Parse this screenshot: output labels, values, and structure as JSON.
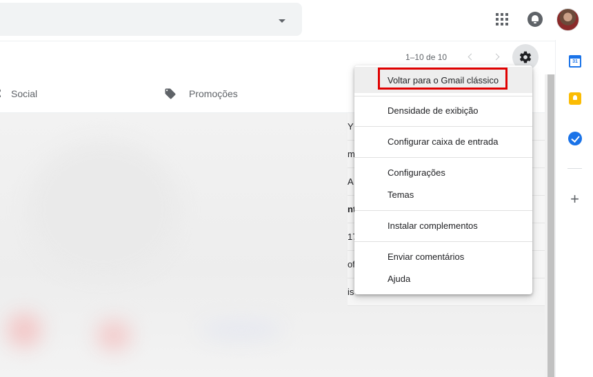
{
  "header": {
    "apps_icon": "apps-grid-icon",
    "notifications_icon": "notifications-icon",
    "avatar": "account-avatar"
  },
  "toolbar": {
    "page_count": "1–10 de 10",
    "settings_icon": "gear-icon"
  },
  "tabs": [
    {
      "label": "Social",
      "icon": "person-icon"
    },
    {
      "label": "Promoções",
      "icon": "tag-icon"
    }
  ],
  "inbox_fragments": [
    "Y",
    "m",
    "A",
    "nt",
    "17",
    "of",
    "is"
  ],
  "settings_menu": {
    "items": [
      "Voltar para o Gmail clássico",
      "Densidade de exibição",
      "Configurar caixa de entrada",
      "Configurações",
      "Temas",
      "Instalar complementos",
      "Enviar comentários",
      "Ajuda"
    ],
    "highlight_color": "#e00000"
  },
  "side_panel": {
    "calendar_label": "31",
    "icons": [
      "calendar-icon",
      "keep-icon",
      "tasks-icon",
      "add-icon"
    ],
    "add_label": "+"
  }
}
